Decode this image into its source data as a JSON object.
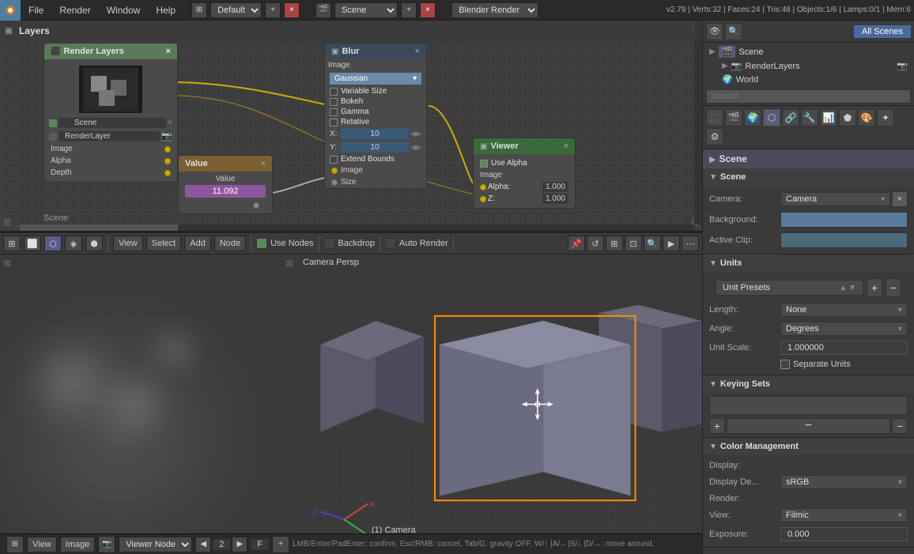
{
  "menubar": {
    "icon": "i",
    "items": [
      "File",
      "Render",
      "Window",
      "Help"
    ],
    "layout_preset": "Default",
    "scene_label": "Scene",
    "renderer": "Blender Render",
    "version_info": "v2.79 | Verts:32 | Faces:24 | Tris:48 | Objects:1/6 | Lamps:0/1 | Mem:6"
  },
  "node_editor": {
    "title": "Layers",
    "nodes": {
      "render_layers": {
        "title": "Render Layers",
        "outputs": [
          "Image",
          "Alpha",
          "Depth"
        ],
        "scene": "Scene",
        "layer": "RenderLayer"
      },
      "blur": {
        "title": "Blur",
        "filter_type": "Gaussian",
        "options": [
          "Variable Size",
          "Bokeh",
          "Gamma",
          "Relative"
        ],
        "x_label": "X:",
        "x_value": "10",
        "y_label": "Y:",
        "y_value": "10",
        "extend_bounds": "Extend Bounds",
        "inputs": [
          "Image",
          "Size"
        ]
      },
      "value": {
        "title": "Value",
        "value_label": "Value",
        "value": "11.092"
      },
      "viewer": {
        "title": "Viewer",
        "use_alpha": "Use Alpha",
        "outputs": [
          "Image"
        ],
        "alpha_label": "Alpha:",
        "alpha_value": "1.000",
        "z_label": "Z:",
        "z_value": "1.000"
      }
    },
    "toolbar": {
      "view": "View",
      "select": "Select",
      "add": "Add",
      "node": "Node",
      "use_nodes": "Use Nodes",
      "backdrop": "Backdrop",
      "auto_render": "Auto Render"
    }
  },
  "viewport": {
    "label": "Camera Persp",
    "camera_label": "(1) Camera"
  },
  "right_panel": {
    "tabs": [
      "view",
      "search",
      "all_scenes"
    ],
    "all_scenes_label": "All Scenes",
    "scene_tree": {
      "scene": "Scene",
      "render_layers": "RenderLayers",
      "world": "World"
    },
    "scene_name": "Scene",
    "sections": {
      "scene": {
        "title": "Scene",
        "camera_label": "Camera:",
        "camera_value": "Camera",
        "background_label": "Background:",
        "active_clip_label": "Active Clip:"
      },
      "units": {
        "title": "Units",
        "presets_label": "Unit Presets",
        "length_label": "Length:",
        "length_value": "None",
        "angle_label": "Angle:",
        "angle_value": "Degrees",
        "unit_scale_label": "Unit Scale:",
        "unit_scale_value": "1.000000",
        "separate_units_label": "Separate Units"
      },
      "keying_sets": {
        "title": "Keying Sets"
      },
      "color_management": {
        "title": "Color Management",
        "display_label": "Display:",
        "display_depth_label": "Display De...",
        "display_depth_value": "sRGB",
        "render_label": "Render:",
        "view_label": "View:",
        "view_value": "Filmic",
        "exposure_label": "Exposure:"
      }
    }
  },
  "bottom_bar": {
    "view": "View",
    "image": "Image",
    "viewer_node": "Viewer Node",
    "frame": "2",
    "f_label": "F",
    "status": "LMB/Enter/PadEnter: confirm, Esc/RMB: cancel, Tab/G: gravity OFF, W/↑ |A/←|S/↓ |D/→: move around,"
  }
}
